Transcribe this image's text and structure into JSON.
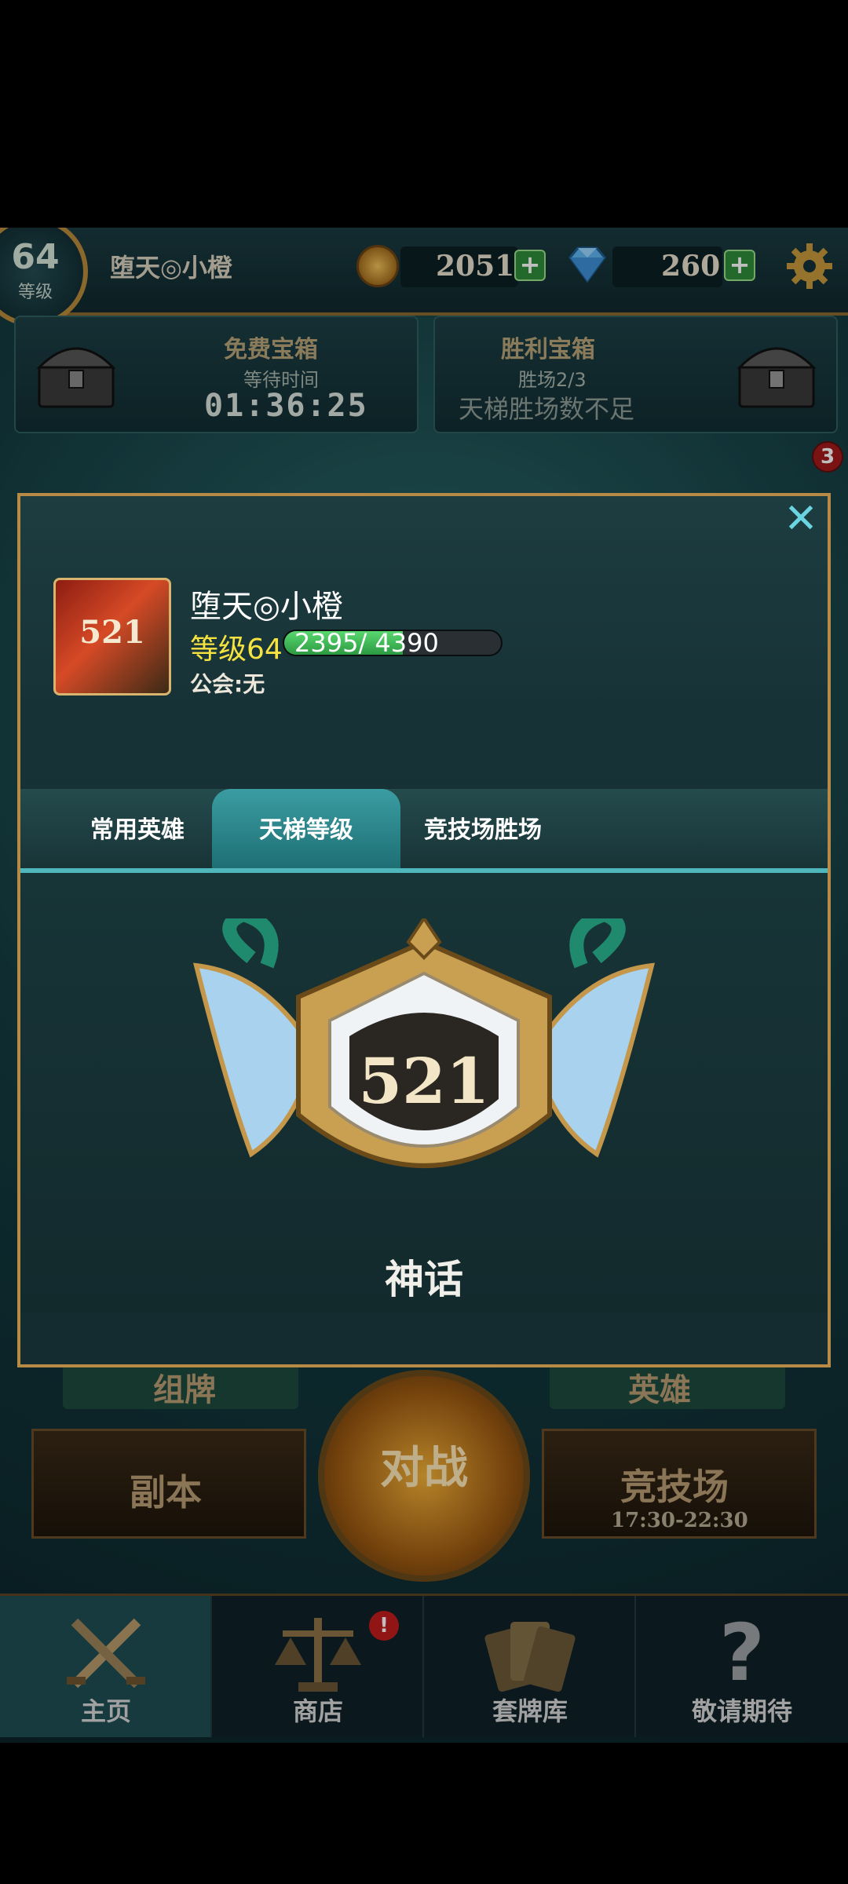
{
  "topbar": {
    "level": "64",
    "level_label": "等级",
    "player_name": "堕天◎小橙",
    "gold": "2051",
    "gems": "260"
  },
  "chests": {
    "free": {
      "title": "免费宝箱",
      "subtitle": "等待时间",
      "timer": "01:36:25"
    },
    "victory": {
      "title": "胜利宝箱",
      "progress": "胜场2/3",
      "status": "天梯胜场数不足"
    },
    "notification_count": "3"
  },
  "background": {
    "deck_label": "组牌",
    "hero_label": "英雄",
    "dungeon_label": "副本",
    "battle_label": "对战",
    "arena_label": "竞技场",
    "arena_time": "17:30-22:30"
  },
  "popup": {
    "close_symbol": "✕",
    "avatar_rank": "521",
    "player_name": "堕天◎小橙",
    "level_label": "等级64",
    "xp_text": "2395/ 4390",
    "xp_fraction": 0.546,
    "guild": "公会:无",
    "tabs": [
      {
        "label": "常用英雄",
        "selected": false
      },
      {
        "label": "天梯等级",
        "selected": true
      },
      {
        "label": "竞技场胜场",
        "selected": false
      }
    ],
    "rank_value": "521",
    "rank_name": "神话"
  },
  "nav": {
    "items": [
      {
        "label": "主页",
        "icon": "crossed-swords-icon",
        "active": true
      },
      {
        "label": "商店",
        "icon": "scales-icon",
        "active": false
      },
      {
        "label": "套牌库",
        "icon": "cards-icon",
        "active": false
      },
      {
        "label": "敬请期待",
        "icon": "question-mark-icon",
        "active": false
      }
    ],
    "shop_badge": "!"
  },
  "colors": {
    "accent_gold": "#b78a46",
    "level_yellow": "#f6e340",
    "xp_green": "#59d76f",
    "close_cyan": "#6ad4e0"
  }
}
